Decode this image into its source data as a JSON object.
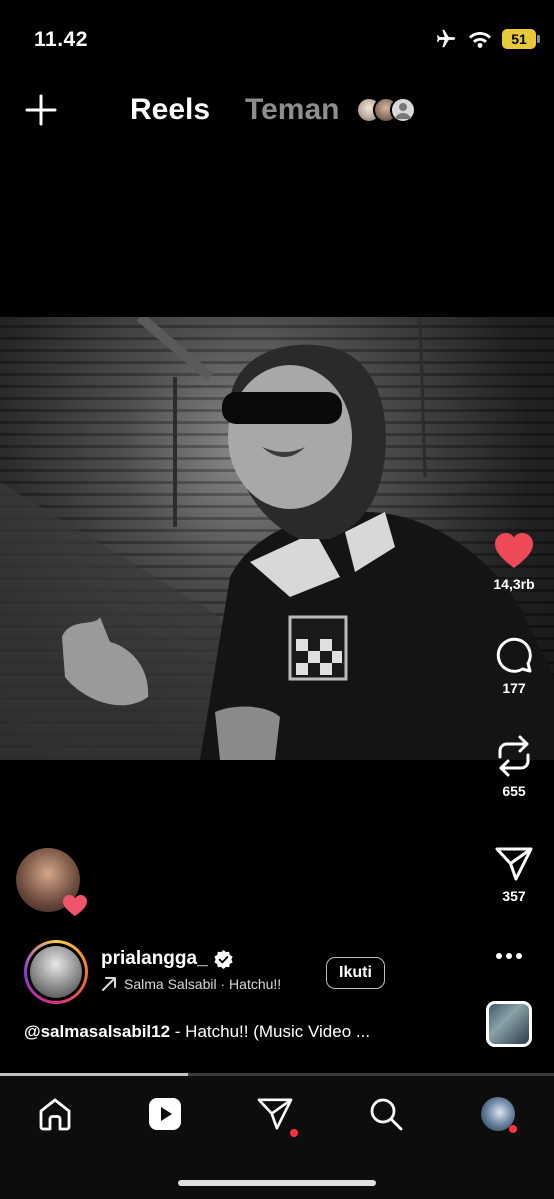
{
  "status_bar": {
    "time": "11.42",
    "battery": "51",
    "icons": [
      "airplane-icon",
      "wifi-icon",
      "battery-icon"
    ]
  },
  "header": {
    "tabs": [
      {
        "label": "Reels",
        "active": true
      },
      {
        "label": "Teman",
        "active": false
      }
    ],
    "add_icon": "plus-icon",
    "friend_avatar_count": 3
  },
  "actions": {
    "like_count": "14,3rb",
    "comment_count": "177",
    "repost_count": "655",
    "share_count": "357",
    "like_color": "#ed4956"
  },
  "post": {
    "username": "prialangga_",
    "verified": true,
    "audio_text": "Salma Salsabil · Hatchu!!",
    "follow_label": "Ikuti",
    "caption_mention": "@salmasalsabil12",
    "caption_text": " - Hatchu!! (Music Video ..."
  },
  "progress": {
    "fraction": 0.34
  },
  "bottom_nav": {
    "items": [
      "home-icon",
      "reels-icon",
      "messages-icon",
      "search-icon",
      "profile-avatar"
    ],
    "active": "reels-icon",
    "notification_color": "#ff3040"
  }
}
